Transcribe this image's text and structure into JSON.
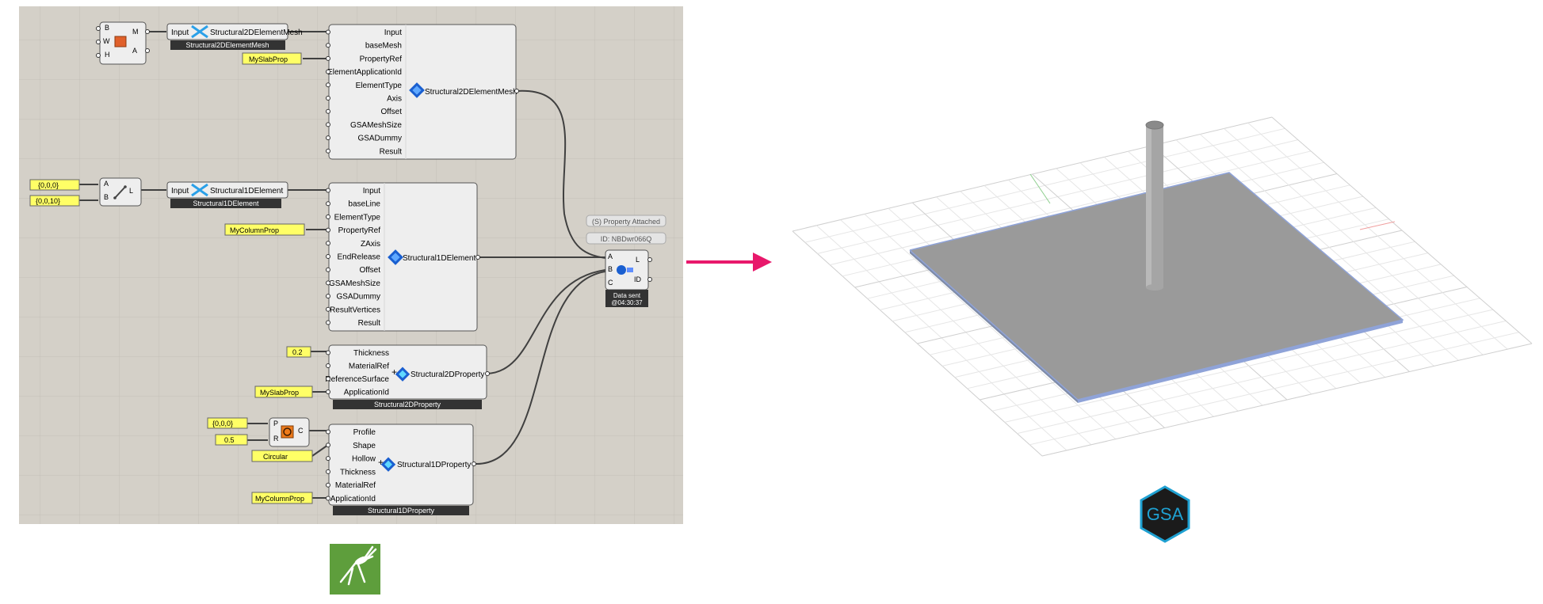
{
  "canvas": {
    "background": "#d4d0c8",
    "grid_line": "#c3bfb8"
  },
  "wires_color": "#404040",
  "panel_color": "#ffff66",
  "arrow_color": "#e8186b",
  "box_top": {
    "inputs": [
      "B",
      "W",
      "H"
    ],
    "outputs": [
      "M",
      "A"
    ],
    "icon": "box-icon"
  },
  "line": {
    "inputs": [
      "A",
      "B"
    ],
    "output": "L",
    "icon": "line-icon",
    "point_a": "{0,0,0}",
    "point_b": "{0,0,10}"
  },
  "circle": {
    "inputs": [
      "P",
      "R"
    ],
    "output": "C",
    "icon": "circle-icon",
    "point": "{0,0,0}",
    "radius": "0.5"
  },
  "convert_2d": {
    "input": "Input",
    "output": "Structural2DElementMesh",
    "tag": "Structural2DElementMesh",
    "icon": "speckle-convert-icon"
  },
  "convert_1d": {
    "input": "Input",
    "output": "Structural1DElement",
    "tag": "Structural1DElement",
    "icon": "speckle-convert-icon"
  },
  "panels": {
    "slab_prop": "MySlabProp",
    "slab_prop2": "MySlabProp",
    "column_prop": "MyColumnProp",
    "column_prop2": "MyColumnProp",
    "thickness": "0.2",
    "shape": "Circular"
  },
  "mesh_component": {
    "inputs": [
      "Input",
      "baseMesh",
      "PropertyRef",
      "ElementApplicationId",
      "ElementType",
      "Axis",
      "Offset",
      "GSAMeshSize",
      "GSADummy",
      "Result"
    ],
    "output": "Structural2DElementMesh"
  },
  "element_component": {
    "inputs": [
      "Input",
      "baseLine",
      "ElementType",
      "PropertyRef",
      "ZAxis",
      "EndRelease",
      "Offset",
      "GSAMeshSize",
      "GSADummy",
      "ResultVertices",
      "Result"
    ],
    "output": "Structural1DElement"
  },
  "prop2d_component": {
    "inputs": [
      "Thickness",
      "MaterialRef",
      "ReferenceSurface",
      "ApplicationId"
    ],
    "output": "Structural2DProperty",
    "tag": "Structural2DProperty"
  },
  "prop1d_component": {
    "inputs": [
      "Profile",
      "Shape",
      "Hollow",
      "Thickness",
      "MaterialRef",
      "ApplicationId"
    ],
    "output": "Structural1DProperty",
    "tag": "Structural1DProperty"
  },
  "sender": {
    "balloon_1": "(S) Property Attached",
    "balloon_2": "ID: NBDwr066Q",
    "inputs": [
      "A",
      "B",
      "C"
    ],
    "outputs": [
      "L",
      "ID"
    ],
    "status_1": "Data sent",
    "status_2": "@04:30:37"
  },
  "logos": {
    "grasshopper": "grasshopper-logo",
    "gsa": "GSA"
  },
  "viewport": {
    "slab_color": "#9a9a9a",
    "slab_edge": "#8fa3d8",
    "column_color": "#a5a5a5",
    "grid_color": "#dedede"
  }
}
